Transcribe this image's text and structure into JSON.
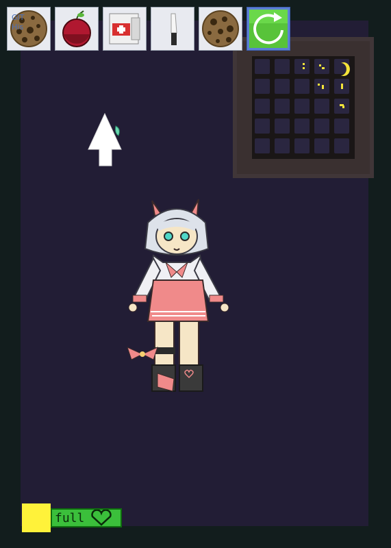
{
  "toolbar": {
    "items": [
      {
        "name": "cookie",
        "overlay_text": "GIT\nHis",
        "icon": "cookie-icon"
      },
      {
        "name": "cherry",
        "icon": "cherry-icon"
      },
      {
        "name": "medkit",
        "icon": "medkit-icon"
      },
      {
        "name": "knife",
        "icon": "knife-icon"
      },
      {
        "name": "cookie-2",
        "icon": "cookie-icon"
      },
      {
        "name": "reset",
        "icon": "refresh-icon",
        "active": true
      }
    ]
  },
  "status": {
    "label": "full",
    "icon": "heart-icon",
    "square_color": "#fff23a",
    "bar_color": "#3bbf3b"
  },
  "colors": {
    "background": "#121d1d",
    "room": "#221d35",
    "window_frame": "#403638",
    "stars": "#f4e43a"
  }
}
